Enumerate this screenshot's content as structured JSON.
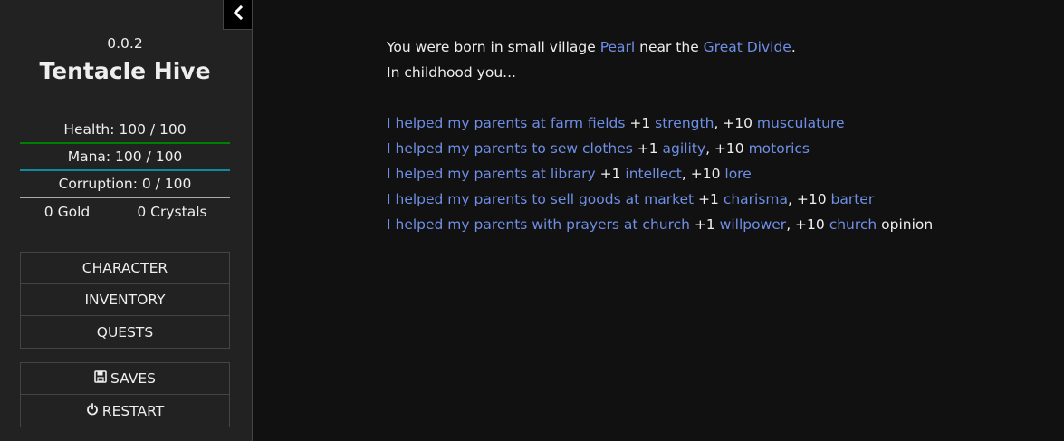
{
  "sidebar": {
    "version": "0.0.2",
    "title": "Tentacle Hive",
    "stats": {
      "health": "Health: 100 / 100",
      "mana": "Mana: 100 / 100",
      "corruption": "Corruption: 0 / 100"
    },
    "currency": {
      "gold": "0 Gold",
      "crystals": "0 Crystals"
    },
    "nav": {
      "character": "CHARACTER",
      "inventory": "INVENTORY",
      "quests": "QUESTS"
    },
    "system": {
      "saves": "SAVES",
      "restart": "RESTART"
    },
    "toggle_icon": "chevron-left-icon"
  },
  "passage": {
    "line1": {
      "prefix": "You were born in small village ",
      "village": "Pearl",
      "middle": " near the ",
      "region": "Great Divide",
      "suffix": "."
    },
    "line2": "In childhood you...",
    "choices": [
      {
        "action": "I helped my parents at farm fields",
        "bonus1": " +1 ",
        "stat": "strength",
        "sep": ", +10 ",
        "skill": "musculature",
        "tail": ""
      },
      {
        "action": "I helped my parents to sew clothes",
        "bonus1": " +1 ",
        "stat": "agility",
        "sep": ", +10 ",
        "skill": "motorics",
        "tail": ""
      },
      {
        "action": "I helped my parents at library",
        "bonus1": " +1 ",
        "stat": "intellect",
        "sep": ", +10 ",
        "skill": "lore",
        "tail": ""
      },
      {
        "action": "I helped my parents to sell goods at market",
        "bonus1": " +1 ",
        "stat": "charisma",
        "sep": ", +10 ",
        "skill": "barter",
        "tail": ""
      },
      {
        "action": "I helped my parents with prayers at church",
        "bonus1": " +1 ",
        "stat": "willpower",
        "sep": ", +10 ",
        "skill": "church",
        "tail": " opinion"
      }
    ]
  },
  "colors": {
    "link": "#6f8fe6",
    "health_bar": "#008000",
    "mana_bar": "#0e8ba1",
    "corruption_bar": "#aaaaaa",
    "background": "#111111",
    "sidebar": "#222222"
  }
}
